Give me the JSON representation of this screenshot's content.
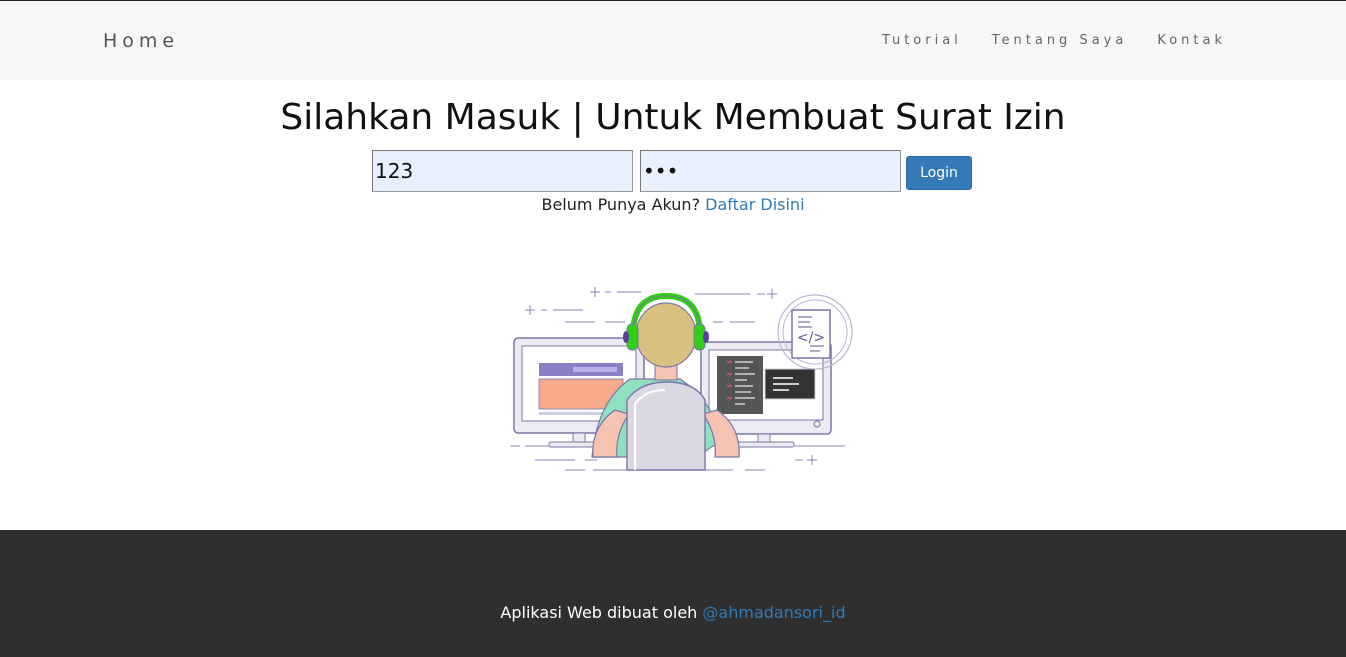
{
  "navbar": {
    "brand": "Home",
    "links": [
      "Tutorial",
      "Tentang Saya",
      "Kontak"
    ]
  },
  "main": {
    "title": "Silahkan Masuk | Untuk Membuat Surat Izin",
    "username_value": "123",
    "password_value": "•••",
    "login_label": "Login",
    "register_prompt": "Belum Punya Akun?",
    "register_link": "Daftar Disini",
    "illustration_code_symbol": "</>"
  },
  "footer": {
    "text": "Aplikasi Web dibuat oleh",
    "link": "@ahmadansori_id"
  },
  "colors": {
    "navbar_bg": "#f7f7f7",
    "footer_bg": "#2f2f2f",
    "accent": "#337ab7",
    "input_bg": "#e8f0fe",
    "headphones": "#2ed012"
  }
}
